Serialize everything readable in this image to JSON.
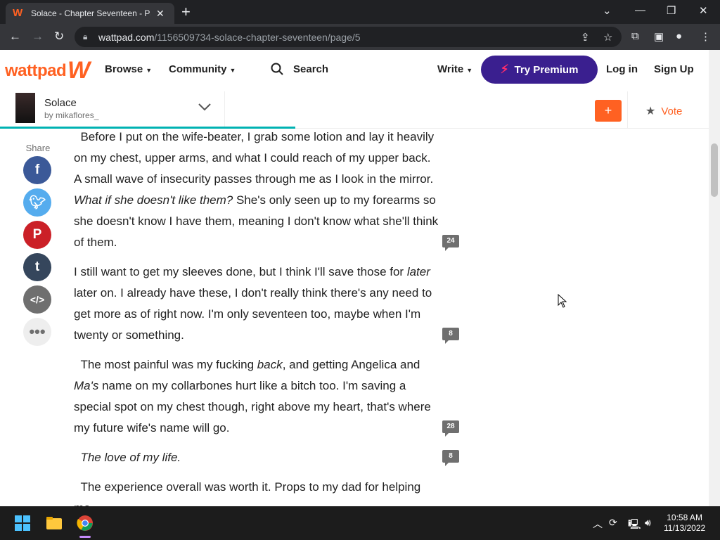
{
  "browser": {
    "tab_title": "Solace - Chapter Seventeen - Pag",
    "url_host": "wattpad.com",
    "url_path": "/1156509734-solace-chapter-seventeen/page/5"
  },
  "header": {
    "logo": "wattpad",
    "browse": "Browse",
    "community": "Community",
    "search": "Search",
    "write": "Write",
    "premium": "Try Premium",
    "login": "Log in",
    "signup": "Sign Up"
  },
  "story": {
    "title": "Solace",
    "author": "by mikaflores_",
    "add": "+",
    "vote": "Vote",
    "reading_progress": 0.41
  },
  "share": {
    "label": "Share",
    "icons": [
      "facebook-icon",
      "twitter-icon",
      "pinterest-icon",
      "tumblr-icon",
      "embed-icon",
      "more-icon"
    ]
  },
  "paragraphs": [
    {
      "html": "&nbsp;&nbsp;Before I put on the wife-beater, I grab some lotion and lay it heavily on my chest, upper arms, and what I could reach of my upper back.&nbsp; A small wave of insecurity passes through me as I look in the mirror. <i>What if she doesn't like them?</i> She's only seen up to my forearms so she doesn't know I have them, meaning I don't know what she'll think of them.",
      "comments": "24"
    },
    {
      "html": "I still want to get my sleeves done, but I think I'll save those for <i>later</i> later on. I already have these, I don't really think there's any need to get more as of right now. I'm only seventeen too, maybe when I'm twenty or something.",
      "comments": "8"
    },
    {
      "html": "&nbsp;&nbsp;The most painful was my fucking <i>back</i>, and getting Angelica and <i>Ma's</i> name on my collarbones hurt like a bitch too. I'm saving a special spot on my chest though, right above my heart, that's where my future wife's name will go.",
      "comments": "28"
    },
    {
      "html": "&nbsp;&nbsp;<i>The love of my life.</i>",
      "comments": "8"
    },
    {
      "html": "&nbsp;&nbsp;The experience overall was worth it. Props to my dad for helping me",
      "comments": ""
    }
  ],
  "taskbar": {
    "time": "10:58 AM",
    "date": "11/13/2022"
  },
  "colors": {
    "brand": "#ff6122",
    "premium": "#3a1f8f",
    "progress": "#00b2b2"
  }
}
